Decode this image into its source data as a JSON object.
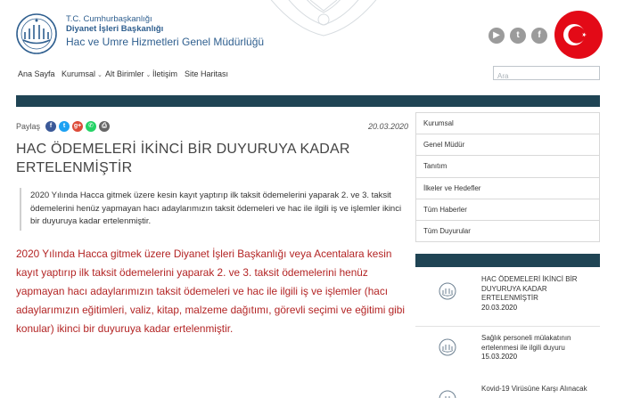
{
  "header": {
    "org_line1": "T.C. Cumhurbaşkanlığı",
    "org_line2": "Diyanet İşleri Başkanlığı",
    "org_line3": "Hac ve Umre Hizmetleri Genel Müdürlüğü",
    "social_icons": [
      "youtube-icon",
      "twitter-icon",
      "facebook-icon"
    ]
  },
  "nav": {
    "items": [
      "Ana Sayfa",
      "Kurumsal",
      "Alt Birimler",
      "İletişim",
      "Site Haritası"
    ],
    "search_placeholder": "Ara"
  },
  "article": {
    "share_label": "Paylaş",
    "share_icons": [
      "facebook-icon",
      "twitter-icon",
      "google-plus-icon",
      "whatsapp-icon",
      "print-icon"
    ],
    "date": "20.03.2020",
    "title": "HAC ÖDEMELERİ İKİNCİ BİR DUYURUYA KADAR ERTELENMİŞTİR",
    "summary": "2020 Yılında Hacca gitmek üzere kesin kayıt yaptırıp ilk taksit ödemelerini yaparak 2. ve 3. taksit ödemelerini henüz yapmayan hacı adaylarımızın taksit ödemeleri ve hac ile ilgili iş ve işlemler ikinci bir duyuruya kadar ertelenmiştir.",
    "body": "2020 Yılında Hacca gitmek üzere Diyanet İşleri Başkanlığı veya Acentalara kesin kayıt yaptırıp ilk taksit ödemelerini yaparak 2. ve 3. taksit ödemelerini henüz yapmayan hacı adaylarımızın taksit ödemeleri ve hac ile ilgili iş ve işlemler (hacı adaylarımızın eğitimleri, valiz, kitap, malzeme dağıtımı, görevli seçimi ve eğitimi gibi konular) ikinci bir duyuruya kadar ertelenmiştir."
  },
  "sidebar": {
    "menu": [
      "Kurumsal",
      "Genel Müdür",
      "Tanıtım",
      "İlkeler ve Hedefler",
      "Tüm Haberler",
      "Tüm Duyurular"
    ],
    "news": [
      {
        "title": "HAC ÖDEMELERİ İKİNCİ BİR DUYURUYA KADAR ERTELENMİŞTİR",
        "date": "20.03.2020"
      },
      {
        "title": "Sağlık personeli mülakatının ertelenmesi ile ilgili duyuru",
        "date": "15.03.2020"
      },
      {
        "title": "Kovid-19 Virüsüne Karşı Alınacak",
        "date": ""
      }
    ]
  },
  "colors": {
    "brand_blue": "#2f5f8f",
    "dark_bar": "#1f4454",
    "body_red": "#b32424",
    "flag_red": "#e30a17"
  }
}
